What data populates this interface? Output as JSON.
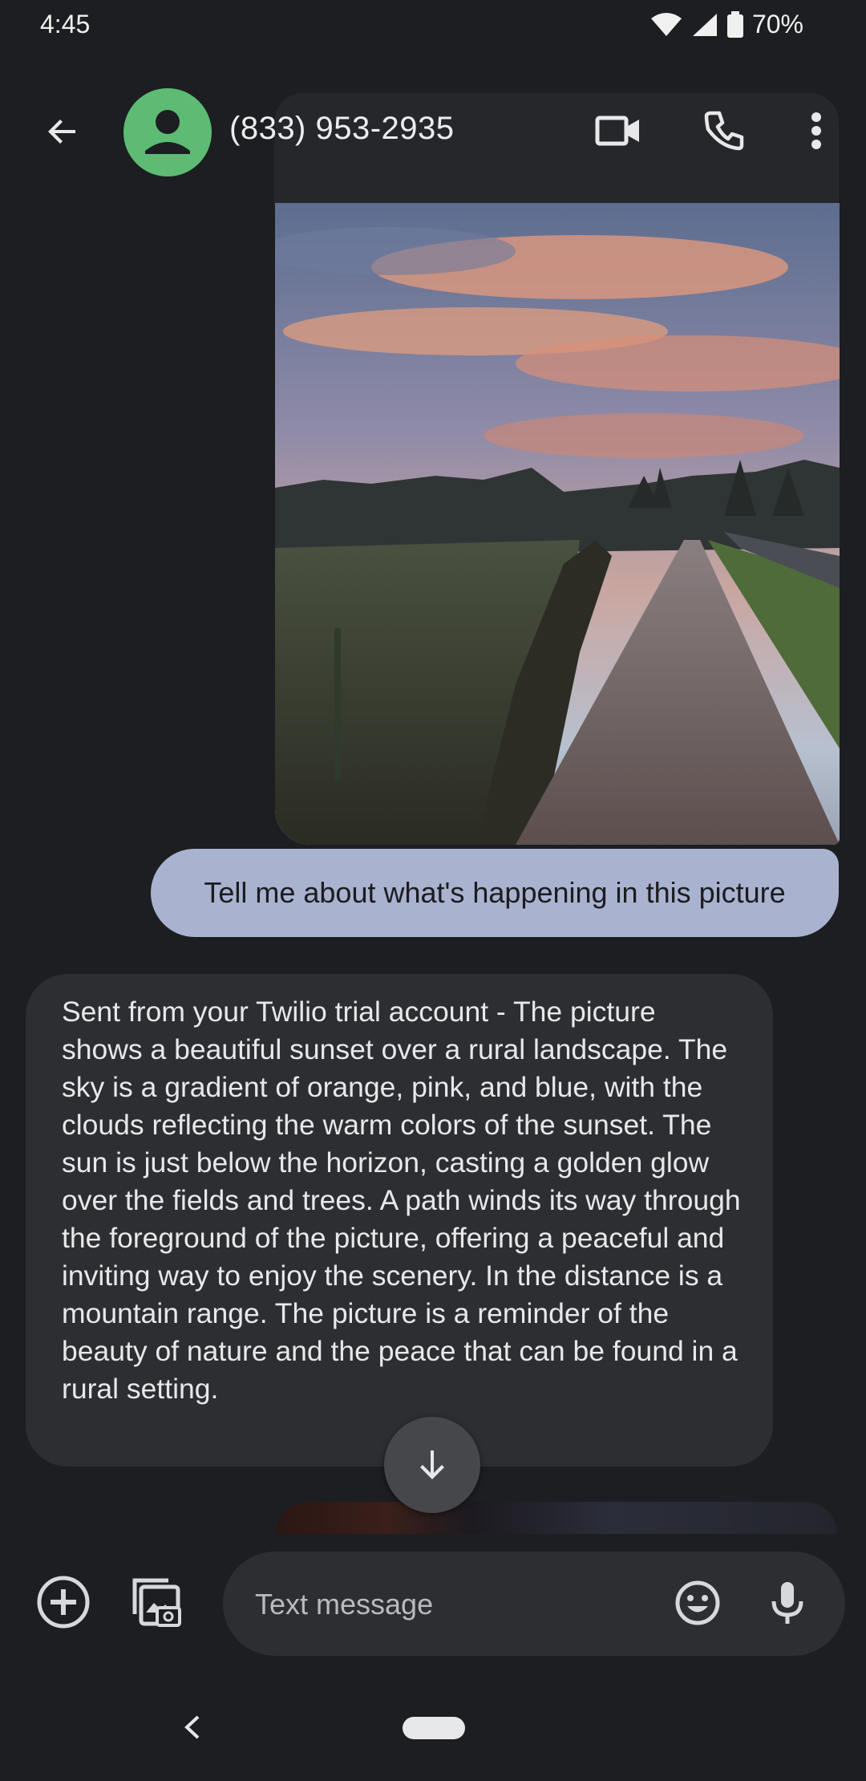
{
  "status_bar": {
    "time": "4:45",
    "battery": "70%",
    "icons": [
      "wifi-icon",
      "signal-icon",
      "battery-icon"
    ]
  },
  "app_bar": {
    "contact": "(833) 953-2935",
    "icons": [
      "back-arrow-icon",
      "person-icon",
      "video-call-icon",
      "phone-icon",
      "more-vert-icon"
    ]
  },
  "messages": [
    {
      "direction": "outgoing",
      "type": "image",
      "icon": "photo-sunset-path"
    },
    {
      "direction": "outgoing",
      "type": "text",
      "text": "Tell me about what's happening in this picture"
    },
    {
      "direction": "incoming",
      "type": "text",
      "text": "Sent from your Twilio trial account - The picture shows a beautiful sunset over a rural landscape. The sky is a gradient of orange, pink, and blue, with the clouds reflecting the warm colors of the sunset. The sun is just below the horizon, casting a golden glow over the fields and trees. A path winds its way through the foreground of the picture, offering a peaceful and inviting way to enjoy the scenery. In the distance is a mountain range. The picture is a reminder of the beauty of nature and the peace that can be found in a rural setting."
    }
  ],
  "composer": {
    "placeholder": "Text message",
    "icons": [
      "add-circle-icon",
      "gallery-camera-icon",
      "emoji-icon",
      "mic-icon"
    ]
  },
  "scroll_button": {
    "icon": "arrow-down-icon"
  },
  "colors": {
    "background": "#1d1e21",
    "outgoing_bubble": "#a9b2cf",
    "incoming_bubble": "#2d2e32",
    "avatar": "#5dbb74"
  }
}
